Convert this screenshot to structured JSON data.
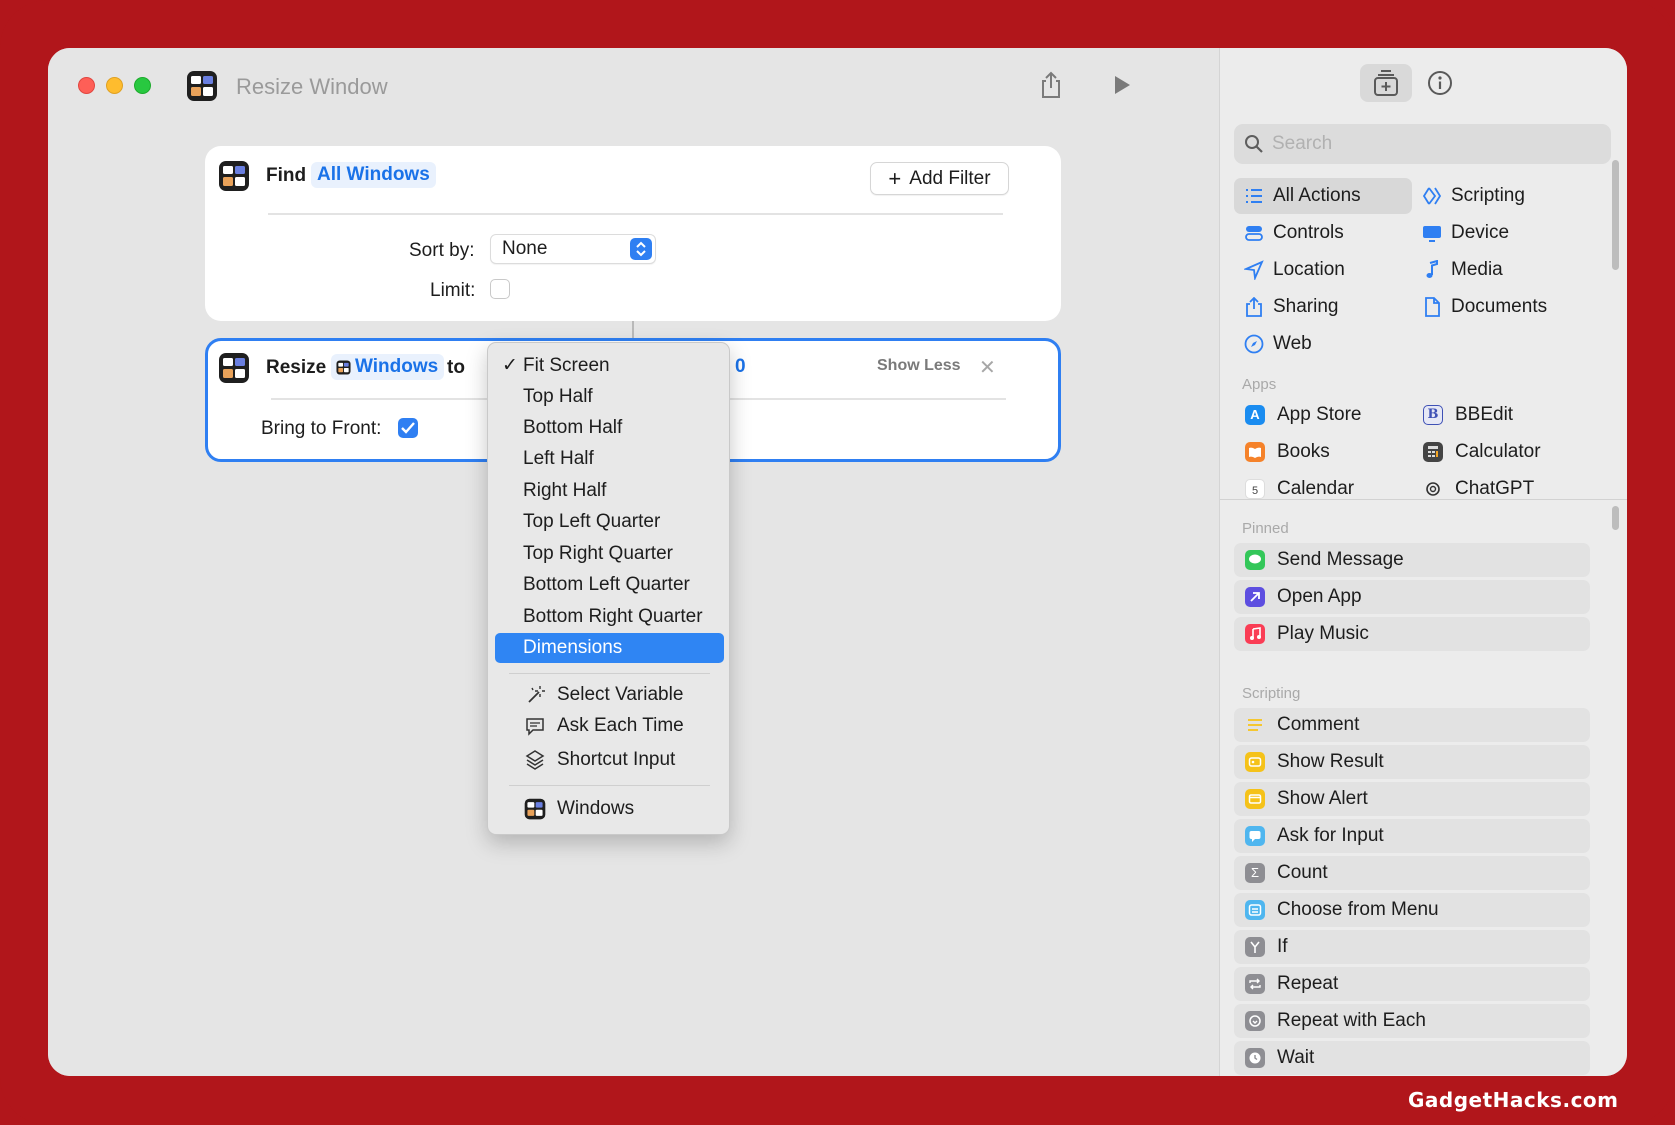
{
  "window": {
    "title": "Resize Window"
  },
  "find_action": {
    "verb": "Find",
    "token": "All Windows",
    "add_filter_label": "Add Filter",
    "sort_by_label": "Sort by:",
    "sort_by_value": "None",
    "limit_label": "Limit:",
    "limit_checked": false
  },
  "resize_action": {
    "verb": "Resize",
    "token": "Windows",
    "to_label": "to",
    "partial_value": "0",
    "show_less_label": "Show Less",
    "bring_front_label": "Bring to Front:",
    "bring_front_checked": true
  },
  "menu": {
    "items": [
      {
        "label": "Fit Screen",
        "checked": true
      },
      {
        "label": "Top Half"
      },
      {
        "label": "Bottom Half"
      },
      {
        "label": "Left Half"
      },
      {
        "label": "Right Half"
      },
      {
        "label": "Top Left Quarter"
      },
      {
        "label": "Top Right Quarter"
      },
      {
        "label": "Bottom Left Quarter"
      },
      {
        "label": "Bottom Right Quarter"
      },
      {
        "label": "Dimensions",
        "highlighted": true
      }
    ],
    "variable_items": [
      {
        "label": "Select Variable",
        "icon": "magic-wand-icon"
      },
      {
        "label": "Ask Each Time",
        "icon": "speech-bubble-icon"
      },
      {
        "label": "Shortcut Input",
        "icon": "shortcut-stack-icon"
      }
    ],
    "windows_item": {
      "label": "Windows",
      "icon": "windows-icon"
    }
  },
  "sidebar": {
    "search_placeholder": "Search",
    "categories": [
      {
        "label": "All Actions",
        "icon": "list-icon",
        "active": true
      },
      {
        "label": "Scripting",
        "icon": "scripting-icon"
      },
      {
        "label": "Controls",
        "icon": "controls-icon"
      },
      {
        "label": "Device",
        "icon": "device-icon"
      },
      {
        "label": "Location",
        "icon": "location-icon"
      },
      {
        "label": "Media",
        "icon": "music-note-icon"
      },
      {
        "label": "Sharing",
        "icon": "share-icon"
      },
      {
        "label": "Documents",
        "icon": "document-icon"
      },
      {
        "label": "Web",
        "icon": "compass-icon"
      }
    ],
    "apps_heading": "Apps",
    "apps": [
      {
        "label": "App Store",
        "icon": "app-store-icon",
        "color": "#1a8cf0"
      },
      {
        "label": "BBEdit",
        "icon": "bbedit-icon",
        "color": "#3f51b5"
      },
      {
        "label": "Books",
        "icon": "books-icon",
        "color": "#f5822a"
      },
      {
        "label": "Calculator",
        "icon": "calculator-icon",
        "color": "#444444"
      },
      {
        "label": "Calendar",
        "icon": "calendar-icon",
        "color": "#ffffff"
      },
      {
        "label": "ChatGPT",
        "icon": "chatgpt-icon",
        "color": "#222222"
      }
    ],
    "pinned_heading": "Pinned",
    "pinned": [
      {
        "label": "Send Message",
        "icon": "messages-icon",
        "color": "#33c759"
      },
      {
        "label": "Open App",
        "icon": "open-app-icon",
        "color": "#5d4ee0"
      },
      {
        "label": "Play Music",
        "icon": "music-icon",
        "color": "#fa3d55"
      }
    ],
    "scripting_heading": "Scripting",
    "scripting": [
      {
        "label": "Comment",
        "icon": "comment-icon",
        "color": "#f5c730"
      },
      {
        "label": "Show Result",
        "icon": "show-result-icon",
        "color": "#f5c219"
      },
      {
        "label": "Show Alert",
        "icon": "show-alert-icon",
        "color": "#f5c219"
      },
      {
        "label": "Ask for Input",
        "icon": "ask-input-icon",
        "color": "#4fb6ef"
      },
      {
        "label": "Count",
        "icon": "sigma-icon",
        "color": "#8e8e93"
      },
      {
        "label": "Choose from Menu",
        "icon": "menu-icon",
        "color": "#4fb6ef"
      },
      {
        "label": "If",
        "icon": "if-branch-icon",
        "color": "#8e8e93"
      },
      {
        "label": "Repeat",
        "icon": "repeat-icon",
        "color": "#8e8e93"
      },
      {
        "label": "Repeat with Each",
        "icon": "repeat-each-icon",
        "color": "#8e8e93"
      },
      {
        "label": "Wait",
        "icon": "clock-icon",
        "color": "#8e8e93"
      }
    ]
  },
  "watermark": "GadgetHacks.com",
  "colors": {
    "accent": "#2f7ff2",
    "frame": "#b1161b"
  }
}
